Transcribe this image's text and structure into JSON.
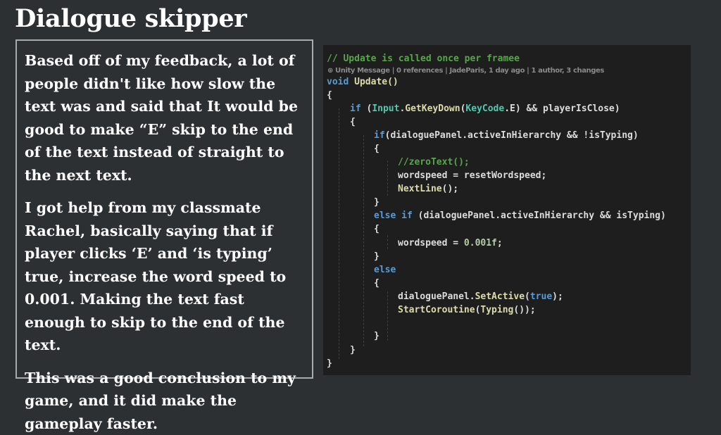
{
  "page": {
    "title": "Dialogue skipper"
  },
  "text_box": {
    "paragraphs": [
      "Based off of my feedback, a lot of people didn't like how slow the text was and said that It would be good to make “E” skip to the end of the text instead of straight to the next text.",
      "I got help from my classmate Rachel, basically saying that if player clicks ‘E’ and ‘is typing’ true, increase the word speed to 0.001. Making the text fast enough to skip to the end of the text.",
      "This was a good conclusion to my game, and it did make the gameplay faster."
    ]
  },
  "code": {
    "comment": "// Update is called once per framee",
    "codelens": "⊕ Unity Message | 0 references | JadeParis, 1 day ago | 1 author, 3 changes",
    "lines": {
      "l1_void": "void",
      "l1_name": " Update()",
      "l2": "{",
      "l3_if": "if",
      "l3_open": " (",
      "l3_input": "Input",
      "l3_dot": ".",
      "l3_fn": "GetKeyDown",
      "l3_paren": "(",
      "l3_keycode": "KeyCode",
      "l3_rest": ".E) && playerIsClose)",
      "l4": "{",
      "l5_if": "if",
      "l5_rest": "(dialoguePanel.activeInHierarchy && !isTyping)",
      "l6": "{",
      "l7": "//zeroText();",
      "l8": "wordspeed = resetWordspeed;",
      "l9_fn": "NextLine",
      "l9_rest": "();",
      "l10": "}",
      "l11_else": "else if",
      "l11_rest": " (dialoguePanel.activeInHierarchy && isTyping)",
      "l12": "{",
      "l13_a": "wordspeed = ",
      "l13_num": "0.001f",
      "l13_b": ";",
      "l14": "}",
      "l15_else": "else",
      "l16": "{",
      "l17_a": "dialoguePanel.",
      "l17_fn": "SetActive",
      "l17_b": "(",
      "l17_kw": "true",
      "l17_c": ");",
      "l18_fn": "StartCoroutine",
      "l18_b": "(",
      "l18_fn2": "Typing",
      "l18_c": "());",
      "l19": "}",
      "l20": "}",
      "l21": "}"
    }
  },
  "colors": {
    "background": "#2d3033",
    "code_background": "#1e1e1e",
    "comment": "#57a64a",
    "keyword": "#569cd6",
    "function": "#dcdcaa",
    "type": "#4ec9b0"
  }
}
